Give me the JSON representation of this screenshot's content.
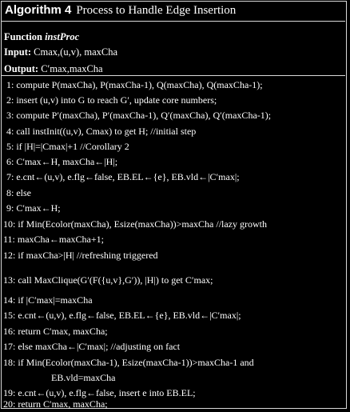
{
  "algorithm": {
    "label": "Algorithm 4",
    "title": "Process to Handle Edge Insertion"
  },
  "header": {
    "function_kw": "Function",
    "function_name": "instProc",
    "input_kw": "Input:",
    "input_text": "Cmax,(u,v), maxCha",
    "output_kw": "Output:",
    "output_text": "C′max,maxCha"
  },
  "lines": [
    "1: compute P(maxCha), P(maxCha-1), Q(maxCha), Q(maxCha-1);",
    "2: insert (u,v) into G to reach G′, update core numbers;",
    "3: compute P′(maxCha), P′(maxCha-1), Q′(maxCha), Q′(maxCha-1);",
    "4: call instInit((u,v), Cmax) to get H;  //initial step",
    "5: if |H|=|Cmax|+1    //Corollary 2",
    "6:     C′max←H, maxCha←|H|;",
    "7:     e.cnt←(u,v), e.flg←false, EB.EL←{e}, EB.vld←|C′max|;",
    "8: else",
    "9:     C′max←H;",
    "10:     if Min(Ecolor(maxCha), Esize(maxCha))>maxCha  //lazy growth",
    "11:         maxCha←maxCha+1;",
    "12:         if maxCha>|H|  //refreshing triggered",
    "13:             call MaxClique(G′(F({u,v},G′)), |H|) to get C′max;",
    "14:             if |C′max|=maxCha",
    "15:                 e.cnt←(u,v), e.flg←false, EB.EL←{e}, EB.vld←|C′max|;",
    "16:                 return C′max, maxCha;",
    "17:             else    maxCha←|C′max|;  //adjusting on fact",
    "18:     if  Min(Ecolor(maxCha-1), Esize(maxCha-1))>maxCha-1 and",
    "EB.vld=maxCha",
    "19:         e.cnt←(u,v), e.flg←false, insert e into EB.EL;",
    "20: return C′max, maxCha;"
  ]
}
